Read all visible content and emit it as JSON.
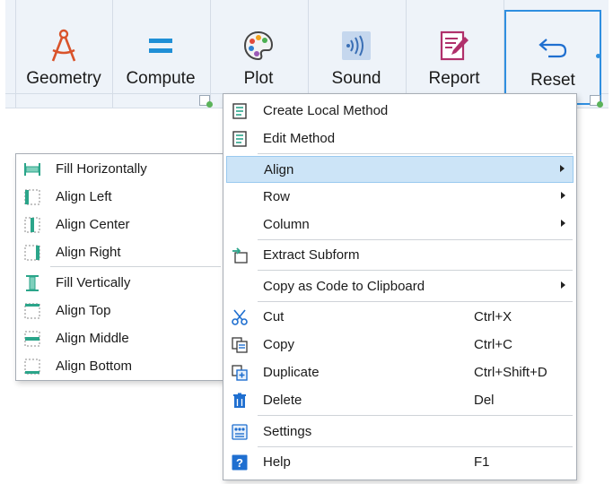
{
  "toolbar": {
    "buttons": [
      {
        "label": "Geometry",
        "icon": "compass-icon"
      },
      {
        "label": "Compute",
        "icon": "equals-icon"
      },
      {
        "label": "Plot",
        "icon": "palette-icon"
      },
      {
        "label": "Sound",
        "icon": "sound-wave-icon"
      },
      {
        "label": "Report",
        "icon": "report-edit-icon"
      },
      {
        "label": "Reset",
        "icon": "undo-arrow-icon"
      }
    ],
    "selected": "Reset"
  },
  "context_menu": {
    "items": [
      {
        "label": "Create Local Method",
        "icon": "method-doc-icon"
      },
      {
        "label": "Edit Method",
        "icon": "method-doc-icon"
      },
      {
        "label": "Align",
        "submenu": true,
        "highlighted": true
      },
      {
        "label": "Row",
        "submenu": true
      },
      {
        "label": "Column",
        "submenu": true
      },
      {
        "label": "Extract Subform",
        "icon": "extract-subform-icon"
      },
      {
        "label": "Copy as Code to Clipboard",
        "submenu": true
      },
      {
        "label": "Cut",
        "shortcut": "Ctrl+X",
        "icon": "scissors-icon"
      },
      {
        "label": "Copy",
        "shortcut": "Ctrl+C",
        "icon": "copy-icon"
      },
      {
        "label": "Duplicate",
        "shortcut": "Ctrl+Shift+D",
        "icon": "duplicate-icon"
      },
      {
        "label": "Delete",
        "shortcut": "Del",
        "icon": "trash-icon"
      },
      {
        "label": "Settings",
        "icon": "settings-icon"
      },
      {
        "label": "Help",
        "shortcut": "F1",
        "icon": "help-icon"
      }
    ]
  },
  "align_submenu": {
    "items": [
      {
        "label": "Fill Horizontally",
        "icon": "fill-horizontally-icon"
      },
      {
        "label": "Align Left",
        "icon": "align-left-icon"
      },
      {
        "label": "Align Center",
        "icon": "align-center-icon"
      },
      {
        "label": "Align Right",
        "icon": "align-right-icon"
      },
      {
        "label": "Fill Vertically",
        "icon": "fill-vertically-icon"
      },
      {
        "label": "Align Top",
        "icon": "align-top-icon"
      },
      {
        "label": "Align Middle",
        "icon": "align-middle-icon"
      },
      {
        "label": "Align Bottom",
        "icon": "align-bottom-icon"
      }
    ]
  },
  "colors": {
    "accent": "#2f8fe0",
    "menu_highlight": "#cce4f7",
    "teal_icon": "#2ba58a"
  }
}
